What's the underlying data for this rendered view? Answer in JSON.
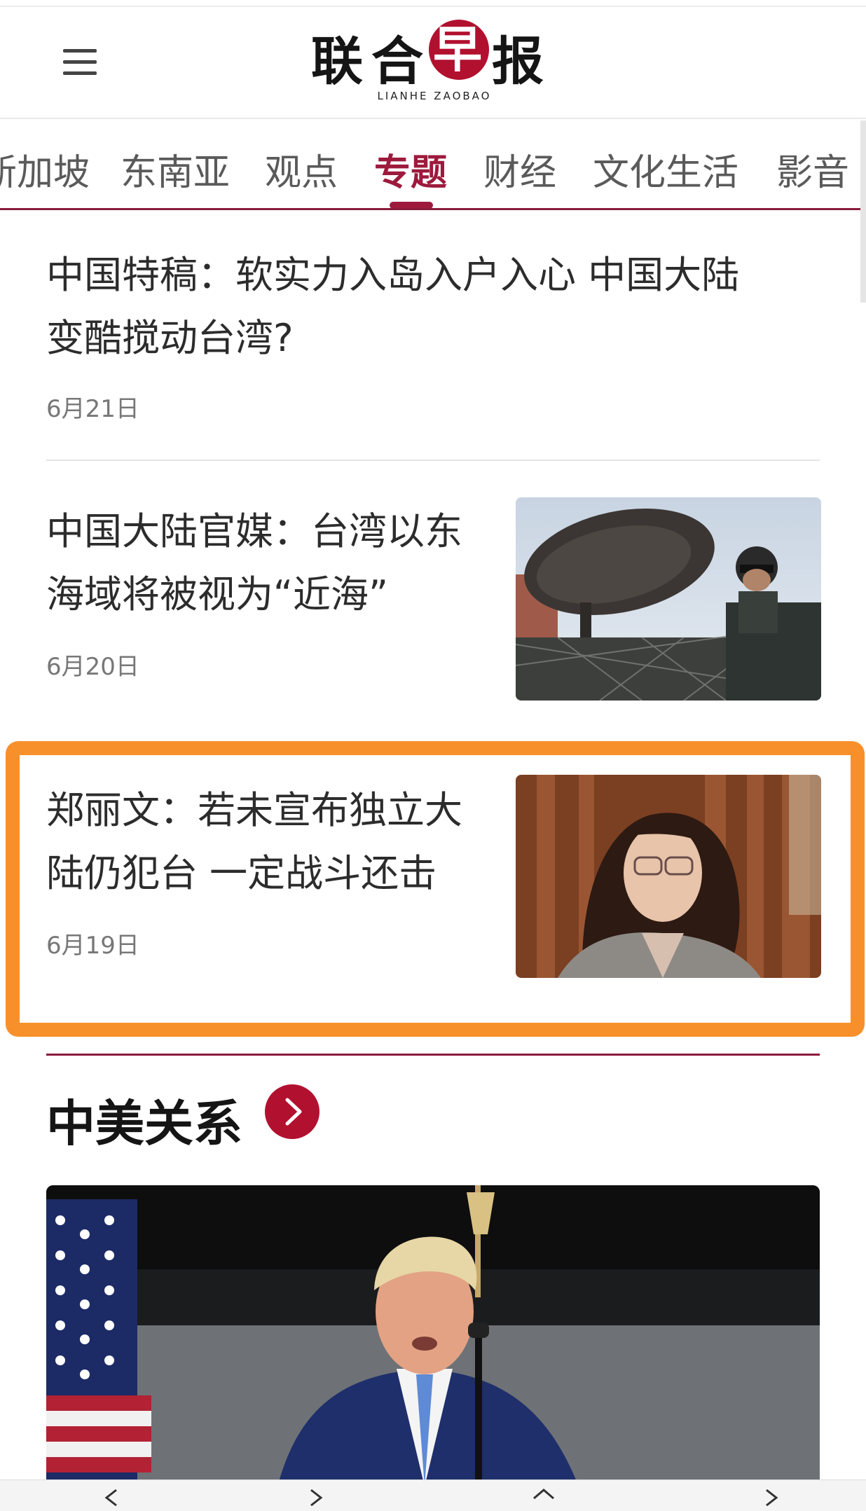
{
  "header": {
    "logo_cn": [
      "联",
      "合",
      "早",
      "报"
    ],
    "logo_en": "LIANHE ZAOBAO",
    "colors": {
      "brand": "#b2102f",
      "accent": "#9d1a3d",
      "highlight": "#f7902b"
    }
  },
  "nav": {
    "tabs": [
      {
        "label": "新加坡"
      },
      {
        "label": "东南亚"
      },
      {
        "label": "观点"
      },
      {
        "label": "专题",
        "active": true
      },
      {
        "label": "财经"
      },
      {
        "label": "文化生活"
      },
      {
        "label": "影音"
      }
    ]
  },
  "articles": [
    {
      "title_line1": "中国特稿：软实力入岛入户入心 中国大陆",
      "title_line2": "变酷搅动台湾?",
      "date": "6月21日"
    },
    {
      "title_line1": "中国大陆官媒：台湾以东",
      "title_line2": "海域将被视为“近海”",
      "date": "6月20日",
      "image": "soldier-with-radar-dish"
    },
    {
      "title_line1": "郑丽文：若未宣布独立大",
      "title_line2": "陆仍犯台 一定战斗还击",
      "date": "6月19日",
      "image": "woman-portrait",
      "highlighted": true
    }
  ],
  "section": {
    "title": "中美关系",
    "icon": "chevron-right-icon"
  },
  "hero_image": "man-speaking-at-podium-with-flag",
  "bottom_bar": {
    "icons": [
      "back-icon",
      "forward-icon",
      "home-icon",
      "tabs-icon"
    ]
  }
}
